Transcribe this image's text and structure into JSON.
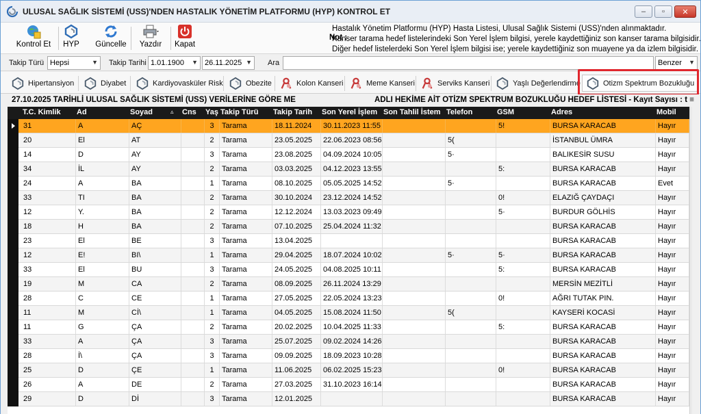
{
  "window": {
    "title": "ULUSAL SAĞLIK SİSTEMİ (USS)'NDEN HASTALIK YÖNETİM PLATFORMU (HYP) KONTROL ET",
    "minimize": "–",
    "maximize": "▫",
    "close": "✕"
  },
  "toolbar": {
    "buttons": [
      {
        "label": "Kontrol Et",
        "icon": "globe-check-icon"
      },
      {
        "label": "HYP",
        "icon": "hyp-logo-icon"
      },
      {
        "label": "Güncelle",
        "icon": "refresh-icon"
      },
      {
        "label": "Yazdır",
        "icon": "printer-icon"
      },
      {
        "label": "Kapat",
        "icon": "power-icon"
      }
    ],
    "note_label": "Not :",
    "note_lines": [
      "Hastalık Yönetim Platformu (HYP) Hasta Listesi, Ulusal Sağlık Sistemi (USS)'nden alınmaktadır.",
      "Kanser tarama hedef listelerindeki Son Yerel İşlem bilgisi, yerele kaydettiğiniz son kanser tarama bilgisidir.",
      "Diğer hedef listelerdeki Son Yerel İşlem bilgisi ise; yerele kaydettiğiniz son muayene ya da izlem bilgisidir."
    ]
  },
  "filters": {
    "takip_turu_label": "Takip Türü",
    "takip_turu_value": "Hepsi",
    "takip_tarihi_label": "Takip Tarihi",
    "date_from": "1.01.1900",
    "date_to": "26.11.2025",
    "ara_label": "Ara",
    "search_value": "",
    "match_mode": "Benzer"
  },
  "categories": [
    {
      "label": "Hipertansiyon",
      "icon": "hyp-logo-icon"
    },
    {
      "label": "Diyabet",
      "icon": "hyp-logo-icon"
    },
    {
      "label": "Kardiyovasküler Risk",
      "icon": "hyp-logo-icon"
    },
    {
      "label": "Obezite",
      "icon": "hyp-logo-icon"
    },
    {
      "label": "Kolon Kanseri",
      "icon": "ribbon-icon"
    },
    {
      "label": "Meme Kanseri",
      "icon": "ribbon-icon"
    },
    {
      "label": "Serviks Kanseri",
      "icon": "ribbon-icon"
    },
    {
      "label": "Yaşlı Değerlendirme",
      "icon": "hyp-logo-icon"
    },
    {
      "label": "Otizm Spektrum Bozukluğu",
      "icon": "hyp-logo-icon"
    }
  ],
  "grid_title": {
    "left": "27.10.2025 TARİHLİ ULUSAL SAĞLIK SİSTEMİ (USS) VERİLERİNE GÖRE ME",
    "right": "ADLI HEKİME AİT OTİZM SPEKTRUM BOZUKLUĞU HEDEF LİSTESİ - Kayıt Sayısı : t ≡"
  },
  "columns": [
    "T.C. Kimlik",
    "Ad",
    "Soyad",
    "Cns",
    "Yaş",
    "Takip Türü",
    "Takip Tarih",
    "Son Yerel İşlem",
    "Son Tahlil İstem",
    "Telefon",
    "GSM",
    "Adres",
    "Mobil"
  ],
  "sort_indicator": "▵",
  "rows": [
    [
      "31",
      "A",
      "AÇ",
      "",
      "3",
      "Tarama",
      "18.11.2024",
      "30.11.2023 11:55",
      "",
      "",
      "5!",
      "BURSA KARACAB",
      "Hayır"
    ],
    [
      "20",
      "El",
      "AT",
      "",
      "2",
      "Tarama",
      "23.05.2025",
      "22.06.2023 08:56",
      "",
      "5(",
      "",
      "İSTANBUL ÜMRA",
      "Hayır"
    ],
    [
      "14",
      "D",
      "AY",
      "",
      "3",
      "Tarama",
      "23.08.2025",
      "04.09.2024 10:05",
      "",
      "5·",
      "",
      "BALIKESİR SUSU",
      "Hayır"
    ],
    [
      "34",
      "İL",
      "AY",
      "",
      "2",
      "Tarama",
      "03.03.2025",
      "04.12.2023 13:55",
      "",
      "",
      "5:",
      "BURSA KARACAB",
      "Hayır"
    ],
    [
      "24",
      "A",
      "BA",
      "",
      "1",
      "Tarama",
      "08.10.2025",
      "05.05.2025 14:52",
      "",
      "5·",
      "",
      "BURSA KARACAB",
      "Evet"
    ],
    [
      "33",
      "TI",
      "BA",
      "",
      "2",
      "Tarama",
      "30.10.2024",
      "23.12.2024 14:52",
      "",
      "",
      "0!",
      "ELAZIĞ ÇAYDAÇI",
      "Hayır"
    ],
    [
      "12",
      "Y.",
      "BA",
      "",
      "2",
      "Tarama",
      "12.12.2024",
      "13.03.2023 09:49",
      "",
      "",
      "5·",
      "BURDUR GÖLHİS",
      "Hayır"
    ],
    [
      "18",
      "H",
      "BA",
      "",
      "2",
      "Tarama",
      "07.10.2025",
      "25.04.2024 11:32",
      "",
      "",
      "",
      "BURSA KARACAB",
      "Hayır"
    ],
    [
      "23",
      "El",
      "BE",
      "",
      "3",
      "Tarama",
      "13.04.2025",
      "",
      "",
      "",
      "",
      "BURSA KARACAB",
      "Hayır"
    ],
    [
      "12",
      "E!",
      "BI\\",
      "",
      "1",
      "Tarama",
      "29.04.2025",
      "18.07.2024 10:02",
      "",
      "5·",
      "5·",
      "BURSA KARACAB",
      "Hayır"
    ],
    [
      "33",
      "El",
      "BU",
      "",
      "3",
      "Tarama",
      "24.05.2025",
      "04.08.2025 10:11",
      "",
      "",
      "5:",
      "BURSA KARACAB",
      "Hayır"
    ],
    [
      "19",
      "M",
      "CA",
      "",
      "2",
      "Tarama",
      "08.09.2025",
      "26.11.2024 13:29",
      "",
      "",
      "",
      "MERSİN MEZİTLİ",
      "Hayır"
    ],
    [
      "28",
      "C",
      "CE",
      "",
      "1",
      "Tarama",
      "27.05.2025",
      "22.05.2024 13:23",
      "",
      "",
      "0!",
      "AĞRI TUTAK PIN.",
      "Hayır"
    ],
    [
      "11",
      "M",
      "Cİ\\",
      "",
      "1",
      "Tarama",
      "04.05.2025",
      "15.08.2024 11:50",
      "",
      "5(",
      "",
      "KAYSERİ KOCASİ",
      "Hayır"
    ],
    [
      "11",
      "G",
      "ÇA",
      "",
      "2",
      "Tarama",
      "20.02.2025",
      "10.04.2025 11:33",
      "",
      "",
      "5:",
      "BURSA KARACAB",
      "Hayır"
    ],
    [
      "33",
      "A",
      "ÇA",
      "",
      "3",
      "Tarama",
      "25.07.2025",
      "09.02.2024 14:26",
      "",
      "",
      "",
      "BURSA KARACAB",
      "Hayır"
    ],
    [
      "28",
      "İ\\",
      "ÇA",
      "",
      "3",
      "Tarama",
      "09.09.2025",
      "18.09.2023 10:28",
      "",
      "",
      "",
      "BURSA KARACAB",
      "Hayır"
    ],
    [
      "25",
      "D",
      "ÇE",
      "",
      "1",
      "Tarama",
      "11.06.2025",
      "06.02.2025 15:23",
      "",
      "",
      "0!",
      "BURSA KARACAB",
      "Hayır"
    ],
    [
      "26",
      "A",
      "DE",
      "",
      "2",
      "Tarama",
      "27.03.2025",
      "31.10.2023 16:14",
      "",
      "",
      "",
      "BURSA KARACAB",
      "Hayır"
    ],
    [
      "29",
      "D",
      "Dİ",
      "",
      "3",
      "Tarama",
      "12.01.2025",
      "",
      "",
      "",
      "",
      "BURSA KARACAB",
      "Hayır"
    ]
  ],
  "colors": {
    "selected_row": "#ffa51f",
    "header_bg": "#1a1a1a",
    "highlight": "#e0262d"
  }
}
